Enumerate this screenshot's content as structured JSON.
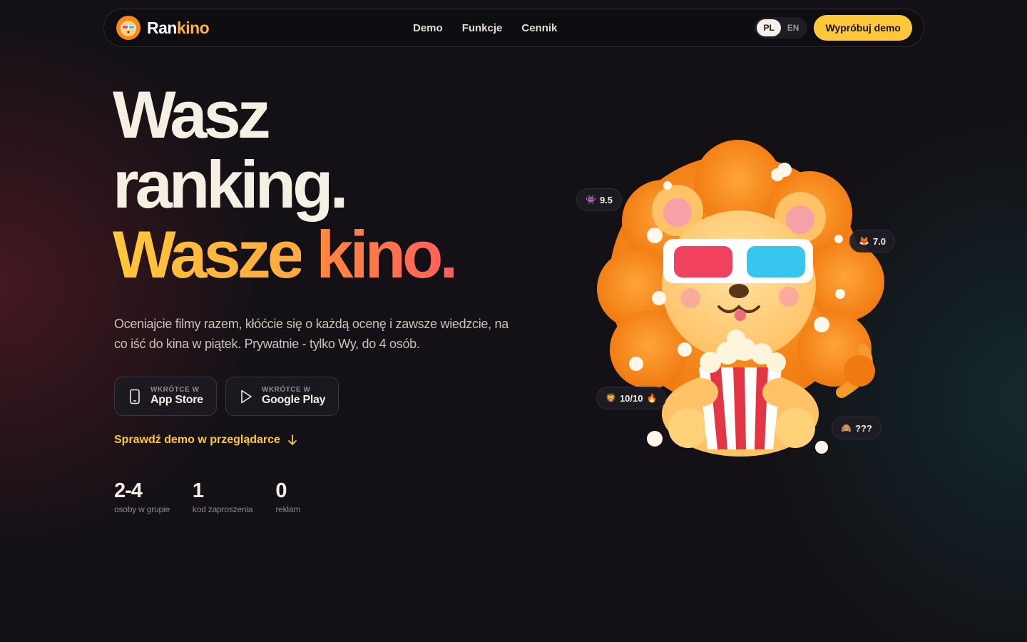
{
  "nav": {
    "brand_a": "Ran",
    "brand_b": "kino",
    "links": [
      "Demo",
      "Funkcje",
      "Cennik"
    ],
    "lang": [
      "PL",
      "EN"
    ],
    "lang_active": "PL",
    "cta": "Wypróbuj demo"
  },
  "hero": {
    "line1": "Wasz",
    "line2": "ranking.",
    "line3a": "Wasze",
    "line3b": "kino.",
    "lead": "Oceniajcie filmy razem, kłóćcie się o każdą ocenę i zawsze wiedzcie, na co iść do kina w piątek. Prywatnie - tylko Wy, do 4 osób."
  },
  "stores": [
    {
      "soon": "WKRÓTCE W",
      "name": "App Store",
      "icon": "phone-icon"
    },
    {
      "soon": "WKRÓTCE W",
      "name": "Google Play",
      "icon": "play-icon"
    }
  ],
  "demo_link": "Sprawdź demo w przeglądarce",
  "stats": [
    {
      "num": "2-4",
      "label": "osoby w grupie"
    },
    {
      "num": "1",
      "label": "kod zaproszenia"
    },
    {
      "num": "0",
      "label": "reklam"
    }
  ],
  "chips": [
    {
      "text": "9.5",
      "icon": "alien-icon"
    },
    {
      "text": "7.0",
      "icon": "fox-icon"
    },
    {
      "text": "10/10",
      "icon": "lion-icon",
      "suffix_icon": "fire-icon"
    },
    {
      "text": "???",
      "icon": "monkey-icon"
    }
  ],
  "colors": {
    "accent": "#ffc83a",
    "accent_orange": "#ff8a3d",
    "bg": "#131116"
  }
}
